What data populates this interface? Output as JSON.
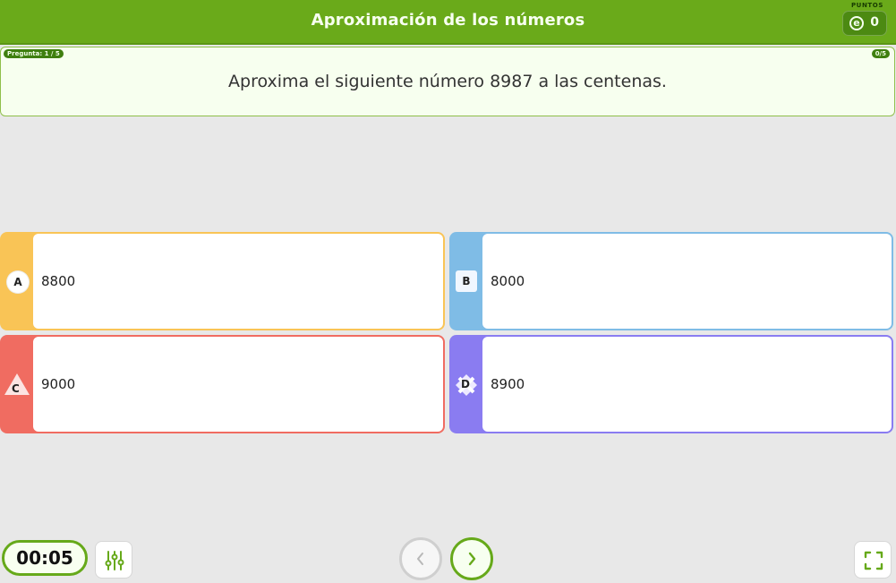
{
  "header": {
    "title": "Aproximación de los números",
    "points_label": "PUNTOS",
    "points_value": "0"
  },
  "question": {
    "progress": "Pregunta: 1 / 5",
    "score": "0/5",
    "text": "Aproxima el siguiente número 8987 a las centenas."
  },
  "answers": [
    {
      "label": "A",
      "value": "8800",
      "color": "#f9c456",
      "shape": "circle"
    },
    {
      "label": "B",
      "value": "8000",
      "color": "#7fbce6",
      "shape": "square"
    },
    {
      "label": "C",
      "value": "9000",
      "color": "#f06c61",
      "shape": "triangle"
    },
    {
      "label": "D",
      "value": "8900",
      "color": "#8a7cf1",
      "shape": "diamond"
    }
  ],
  "footer": {
    "timer": "00:05",
    "settings_icon": "sliders-icon",
    "prev_icon": "chevron-left-icon",
    "next_icon": "chevron-right-icon",
    "fullscreen_icon": "fullscreen-icon"
  },
  "colors": {
    "header_green": "#6aaa1a",
    "accent_green": "#66a91a",
    "background": "#e8e8e8"
  }
}
